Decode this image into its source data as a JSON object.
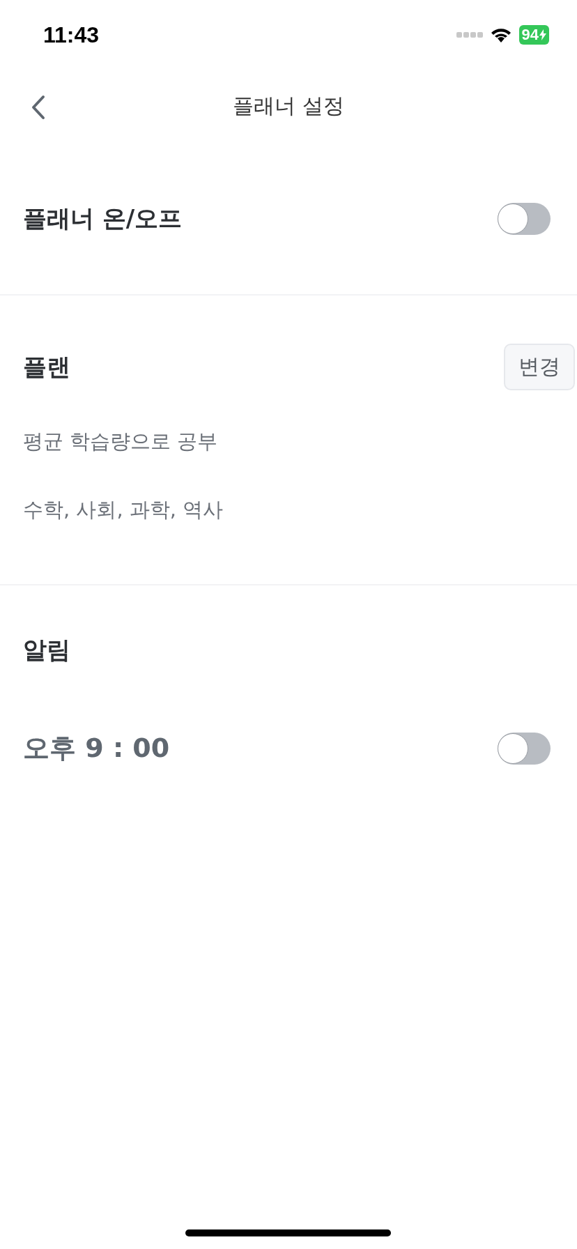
{
  "status_bar": {
    "time": "11:43",
    "battery": "94"
  },
  "nav": {
    "title": "플래너 설정"
  },
  "planner_toggle": {
    "label": "플래너 온/오프",
    "on": false
  },
  "plan": {
    "title": "플랜",
    "button": "변경",
    "lines": [
      "평균 학습량으로 공부",
      "수학, 사회, 과학, 역사"
    ]
  },
  "alarm": {
    "title": "알림",
    "time": "오후 9 : 00",
    "on": false
  }
}
